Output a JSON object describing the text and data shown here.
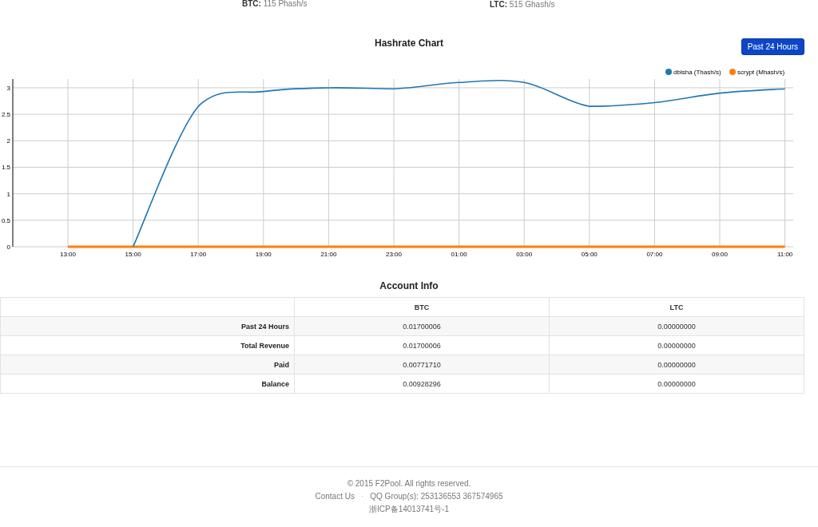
{
  "stats": [
    {
      "label": "BTC:",
      "value": "115 Phash/s"
    },
    {
      "label": "LTC:",
      "value": "515 Ghash/s"
    }
  ],
  "chart_section": {
    "title": "Hashrate Chart",
    "range_button": "Past 24 Hours",
    "chart_data": {
      "type": "line",
      "categories": [
        "13:00",
        "15:00",
        "17:00",
        "19:00",
        "21:00",
        "23:00",
        "01:00",
        "03:00",
        "05:00",
        "07:00",
        "09:00",
        "11:00"
      ],
      "series": [
        {
          "name": "dblsha (Thash/s)",
          "color": "#1f77b4",
          "values": [
            null,
            0,
            2.65,
            2.93,
            3.0,
            2.98,
            3.1,
            3.1,
            2.65,
            2.72,
            2.9,
            2.98
          ]
        },
        {
          "name": "scrypt (Mhash/s)",
          "color": "#ff7f0e",
          "values": [
            0,
            0,
            0,
            0,
            0,
            0,
            0,
            0,
            0,
            0,
            0,
            0
          ]
        }
      ],
      "ylim": [
        0,
        3.15
      ],
      "yticks": [
        0,
        0.5,
        1,
        1.5,
        2,
        2.5,
        3
      ],
      "grid": true,
      "legend": true
    }
  },
  "account_info": {
    "title": "Account Info",
    "columns": [
      "BTC",
      "LTC"
    ],
    "rows": [
      {
        "label": "Past 24 Hours",
        "values": [
          "0.01700006",
          "0.00000000"
        ]
      },
      {
        "label": "Total Revenue",
        "values": [
          "0.01700006",
          "0.00000000"
        ]
      },
      {
        "label": "Paid",
        "values": [
          "0.00771710",
          "0.00000000"
        ]
      },
      {
        "label": "Balance",
        "values": [
          "0.00928296",
          "0.00000000"
        ]
      }
    ]
  },
  "footer": {
    "copyright": "© 2015 F2Pool. All rights reserved.",
    "contact_link": "Contact Us",
    "separator": "·",
    "qq_groups": "QQ Group(s): 253136553 367574965",
    "icp": "浙ICP备14013741号-1"
  }
}
